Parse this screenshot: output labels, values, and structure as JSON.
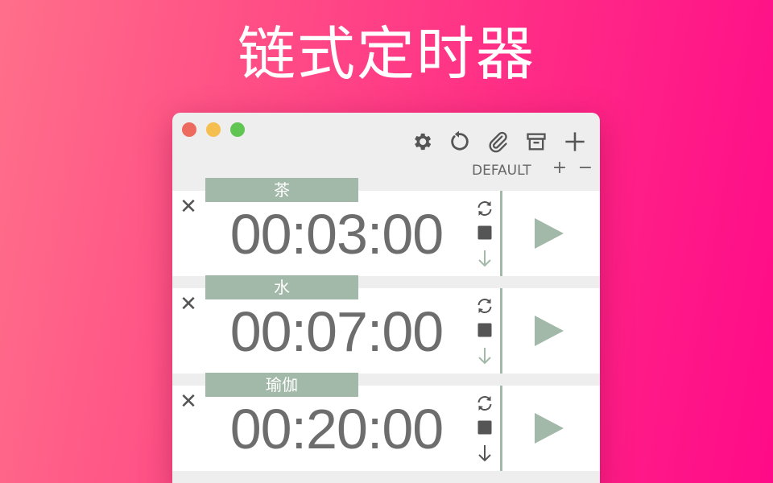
{
  "hero": {
    "title": "链式定时器"
  },
  "toolbar": {
    "icons": [
      "gear-icon",
      "reset-icon",
      "paperclip-icon",
      "archive-icon",
      "plus-icon"
    ]
  },
  "preset": {
    "label": "DEFAULT",
    "add_label": "+",
    "remove_label": "−"
  },
  "timers": [
    {
      "name": "茶",
      "time": "00:03:00",
      "close_label": "✕",
      "down_active": false
    },
    {
      "name": "水",
      "time": "00:07:00",
      "close_label": "✕",
      "down_active": false
    },
    {
      "name": "瑜伽",
      "time": "00:20:00",
      "close_label": "✕",
      "down_active": true
    }
  ],
  "colors": {
    "accent": "#a2b8a8",
    "window_bg": "#eeeeef",
    "text": "#6d6d6d",
    "down_arrow_inactive": "#a2b8a8",
    "down_arrow_active": "#555555"
  }
}
